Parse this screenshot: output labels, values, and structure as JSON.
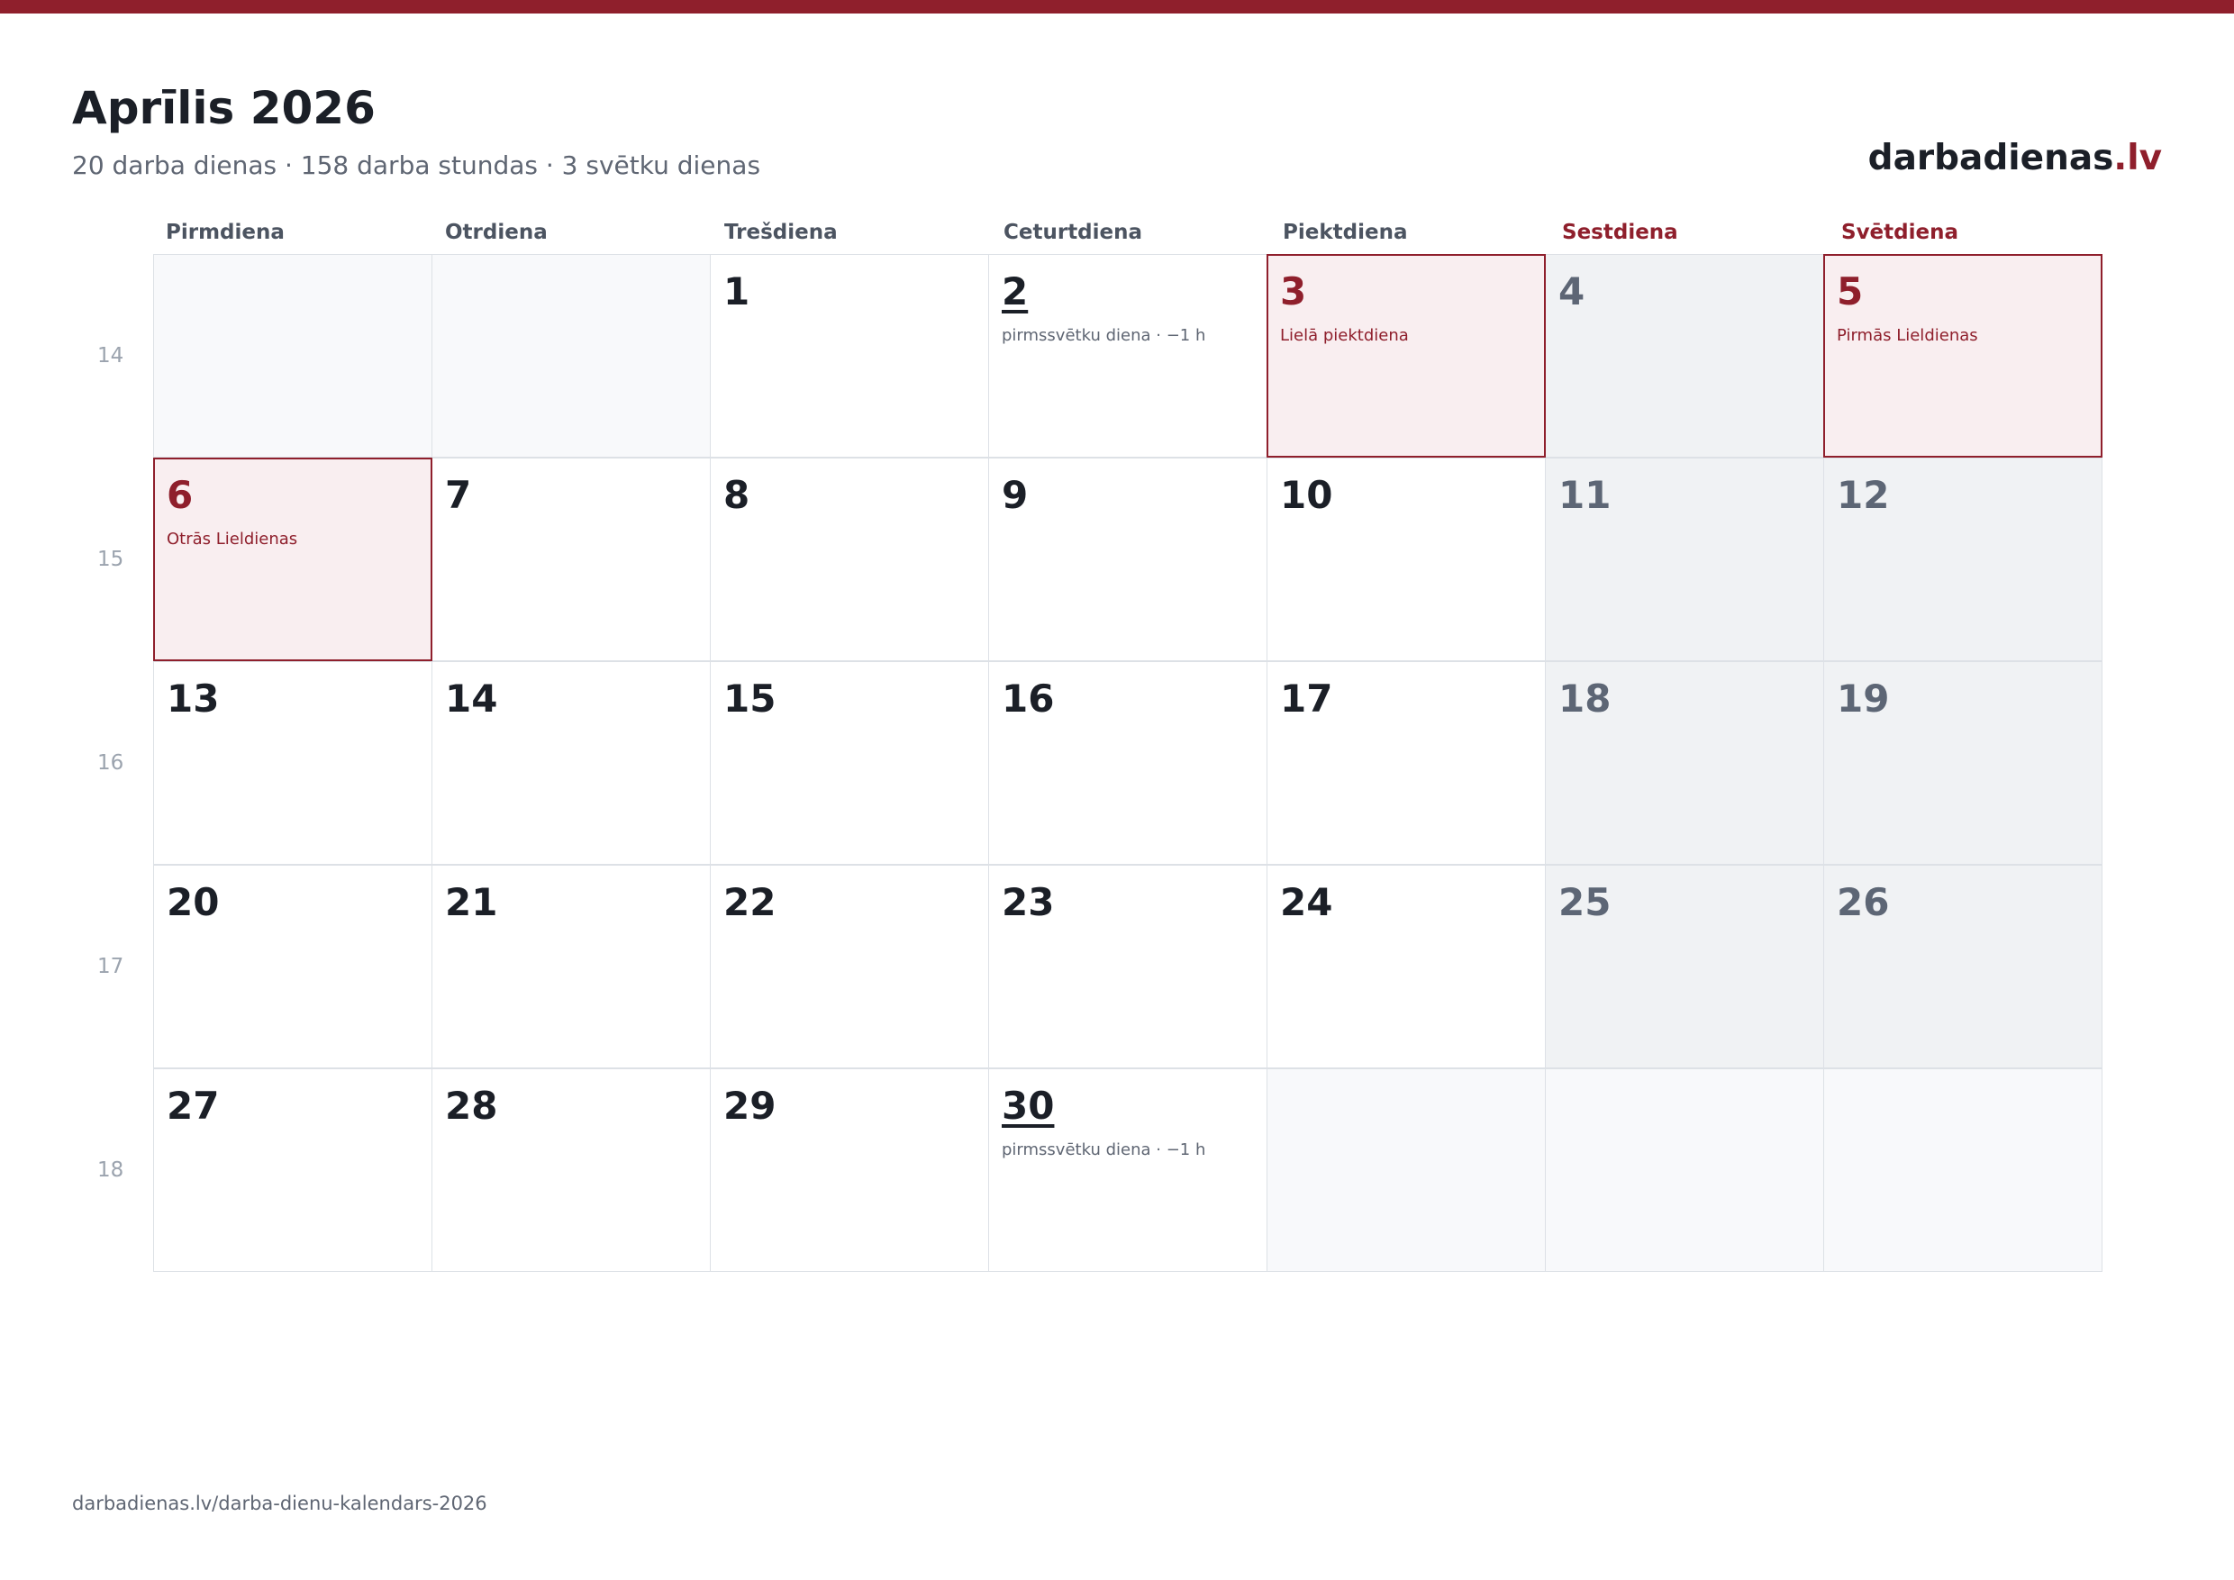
{
  "title": "Aprīlis 2026",
  "subtitle": "20 darba dienas · 158 darba stundas · 3 svētku dienas",
  "brand": {
    "name": "darbadienas",
    "tld": ".lv"
  },
  "weekdays": [
    {
      "label": "Pirmdiena",
      "weekend": false
    },
    {
      "label": "Otrdiena",
      "weekend": false
    },
    {
      "label": "Trešdiena",
      "weekend": false
    },
    {
      "label": "Ceturtdiena",
      "weekend": false
    },
    {
      "label": "Piektdiena",
      "weekend": false
    },
    {
      "label": "Sestdiena",
      "weekend": true
    },
    {
      "label": "Svētdiena",
      "weekend": true
    }
  ],
  "weeks": [
    {
      "number": "14",
      "days": [
        {
          "day": "",
          "kind": "outside"
        },
        {
          "day": "",
          "kind": "outside"
        },
        {
          "day": "1",
          "kind": "work"
        },
        {
          "day": "2",
          "kind": "pre",
          "note": "pirmssvētku diena · −1 h"
        },
        {
          "day": "3",
          "kind": "holiday",
          "note": "Lielā piektdiena"
        },
        {
          "day": "4",
          "kind": "weekend"
        },
        {
          "day": "5",
          "kind": "holiday",
          "note": "Pirmās Lieldienas"
        }
      ]
    },
    {
      "number": "15",
      "days": [
        {
          "day": "6",
          "kind": "holiday",
          "note": "Otrās Lieldienas"
        },
        {
          "day": "7",
          "kind": "work"
        },
        {
          "day": "8",
          "kind": "work"
        },
        {
          "day": "9",
          "kind": "work"
        },
        {
          "day": "10",
          "kind": "work"
        },
        {
          "day": "11",
          "kind": "weekend"
        },
        {
          "day": "12",
          "kind": "weekend"
        }
      ]
    },
    {
      "number": "16",
      "days": [
        {
          "day": "13",
          "kind": "work"
        },
        {
          "day": "14",
          "kind": "work"
        },
        {
          "day": "15",
          "kind": "work"
        },
        {
          "day": "16",
          "kind": "work"
        },
        {
          "day": "17",
          "kind": "work"
        },
        {
          "day": "18",
          "kind": "weekend"
        },
        {
          "day": "19",
          "kind": "weekend"
        }
      ]
    },
    {
      "number": "17",
      "days": [
        {
          "day": "20",
          "kind": "work"
        },
        {
          "day": "21",
          "kind": "work"
        },
        {
          "day": "22",
          "kind": "work"
        },
        {
          "day": "23",
          "kind": "work"
        },
        {
          "day": "24",
          "kind": "work"
        },
        {
          "day": "25",
          "kind": "weekend"
        },
        {
          "day": "26",
          "kind": "weekend"
        }
      ]
    },
    {
      "number": "18",
      "days": [
        {
          "day": "27",
          "kind": "work"
        },
        {
          "day": "28",
          "kind": "work"
        },
        {
          "day": "29",
          "kind": "work"
        },
        {
          "day": "30",
          "kind": "pre",
          "note": "pirmssvētku diena · −1 h"
        },
        {
          "day": "",
          "kind": "outside"
        },
        {
          "day": "",
          "kind": "outside"
        },
        {
          "day": "",
          "kind": "outside"
        }
      ]
    }
  ],
  "footer": {
    "url": "darbadienas.lv/darba-dienu-kalendars-2026"
  },
  "colors": {
    "accent": "#8f1f2c",
    "holiday_bg": "#f9eef0",
    "weekend_bg": "#f0f2f4",
    "outside_bg": "#f8f9fb"
  }
}
